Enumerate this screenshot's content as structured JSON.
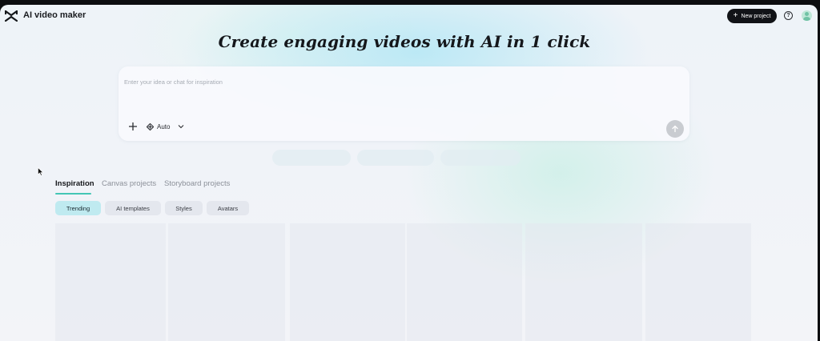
{
  "header": {
    "app_title": "AI video maker",
    "new_project_label": "New project",
    "help_symbol": "?"
  },
  "hero": {
    "title": "Create engaging videos with AI in 1 click"
  },
  "prompt": {
    "placeholder": "Enter your idea or chat for inspiration",
    "value": "",
    "mode_label": "Auto"
  },
  "tabs": [
    {
      "label": "Inspiration",
      "active": true
    },
    {
      "label": "Canvas projects",
      "active": false
    },
    {
      "label": "Storyboard projects",
      "active": false
    }
  ],
  "chips": [
    {
      "label": "Trending",
      "active": true
    },
    {
      "label": "AI templates",
      "active": false
    },
    {
      "label": "Styles",
      "active": false
    },
    {
      "label": "Avatars",
      "active": false
    }
  ],
  "colors": {
    "accent": "#43c6b5",
    "active_chip": "#bfeaf0",
    "primary_button": "#111317"
  },
  "icons": [
    "capcut-logo-icon",
    "plus-icon",
    "help-icon",
    "avatar-icon",
    "add-icon",
    "auto-mode-icon",
    "chevron-down-icon",
    "send-arrow-icon",
    "mouse-cursor-icon"
  ]
}
